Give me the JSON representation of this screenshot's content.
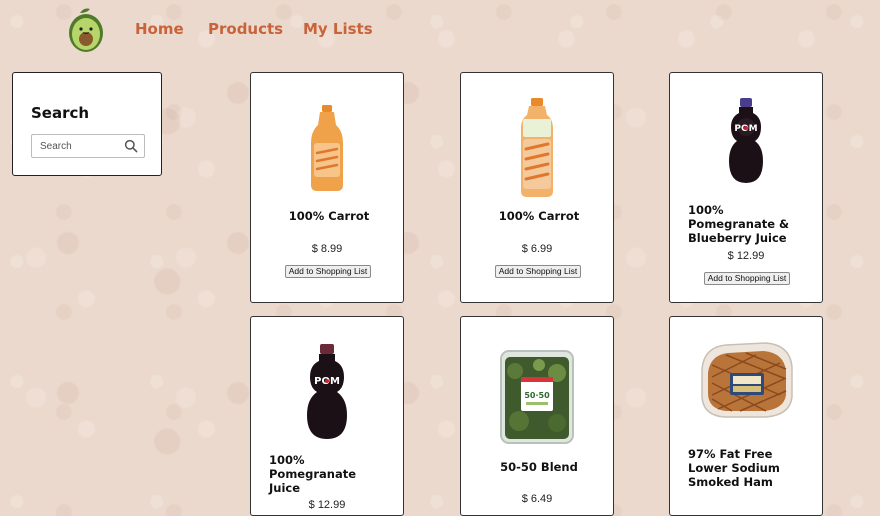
{
  "nav": {
    "home": "Home",
    "products": "Products",
    "my_lists": "My Lists"
  },
  "search": {
    "title": "Search",
    "placeholder": "Search"
  },
  "products": [
    {
      "name": "100% Carrot",
      "price": "$ 8.99",
      "button": "Add to Shopping List",
      "image": "carrot-juice-bottle"
    },
    {
      "name": "100% Carrot",
      "price": "$ 6.99",
      "button": "Add to Shopping List",
      "image": "carrot-juice-bottle-tall"
    },
    {
      "name": "100% Pomegranate & Blueberry Juice",
      "price": "$ 12.99",
      "button": "Add to Shopping List",
      "image": "pom-bottle"
    },
    {
      "name": "100% Pomegranate Juice",
      "price": "$ 12.99",
      "image": "pom-bottle"
    },
    {
      "name": "50-50 Blend",
      "price": "$ 6.49",
      "image": "salad-greens-container"
    },
    {
      "name": "97% Fat Free Lower Sodium Smoked Ham",
      "image": "smoked-ham"
    }
  ],
  "colors": {
    "nav_link": "#c8633a",
    "background": "#ecd9cd"
  }
}
